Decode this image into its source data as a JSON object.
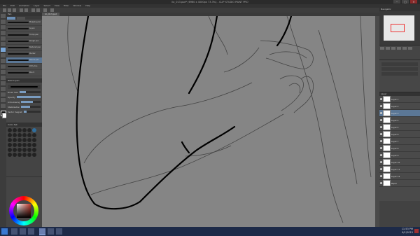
{
  "window": {
    "title": "ilo_013.psd* (6960 x 4000px 73.3%) - CLIP STUDIO PAINT PRO"
  },
  "window_controls": {
    "minimize": "–",
    "maximize": "□",
    "close": "✕"
  },
  "menu": [
    "File",
    "Edit",
    "Animation",
    "Layer",
    "Select",
    "View",
    "Filter",
    "Window",
    "Help"
  ],
  "tool_palette": {
    "active_tool": "pen",
    "icons": [
      "zoom-icon",
      "hand-icon",
      "rotate-icon",
      "move-icon",
      "select-icon",
      "eyedropper-icon",
      "pen-icon",
      "pencil-icon",
      "brush-icon",
      "airbrush-icon",
      "eraser-icon",
      "blend-icon",
      "fill-icon",
      "gradient-icon",
      "figure-icon",
      "ruler-icon",
      "text-icon",
      "balloon-icon"
    ]
  },
  "sub_tool": {
    "title": "Pen",
    "brushes": [
      "Mapping pen",
      "G-pen",
      "Turnip pen",
      "Rough pen",
      "Textured pen",
      "Marker",
      "Real G-pen",
      "Dirty line",
      "Pen 9"
    ]
  },
  "tool_property": {
    "title": "Real G-pen",
    "rows": [
      "Brush Size",
      "Opacity",
      "Anti-aliasing",
      "Stabilization",
      "Vector magnet"
    ]
  },
  "color_set": {
    "title": "Color Set"
  },
  "document_tab": "ilo_013.psd",
  "colors": {
    "canvas": "#858585",
    "accent": "#5b7796",
    "taskbar": "#1d2a48"
  },
  "navigator": {
    "title": "Navigator"
  },
  "layers": {
    "title": "Layer",
    "items": [
      "Layer 1",
      "Layer 2",
      "Layer 3",
      "Layer 4",
      "Layer 5",
      "Layer 6",
      "Layer 7",
      "Layer 8",
      "Layer 9",
      "Layer 10",
      "Layer 11",
      "Layer 12",
      "Paper"
    ]
  },
  "taskbar": {
    "time": "11:53 PM",
    "date": "6/1/2015"
  }
}
